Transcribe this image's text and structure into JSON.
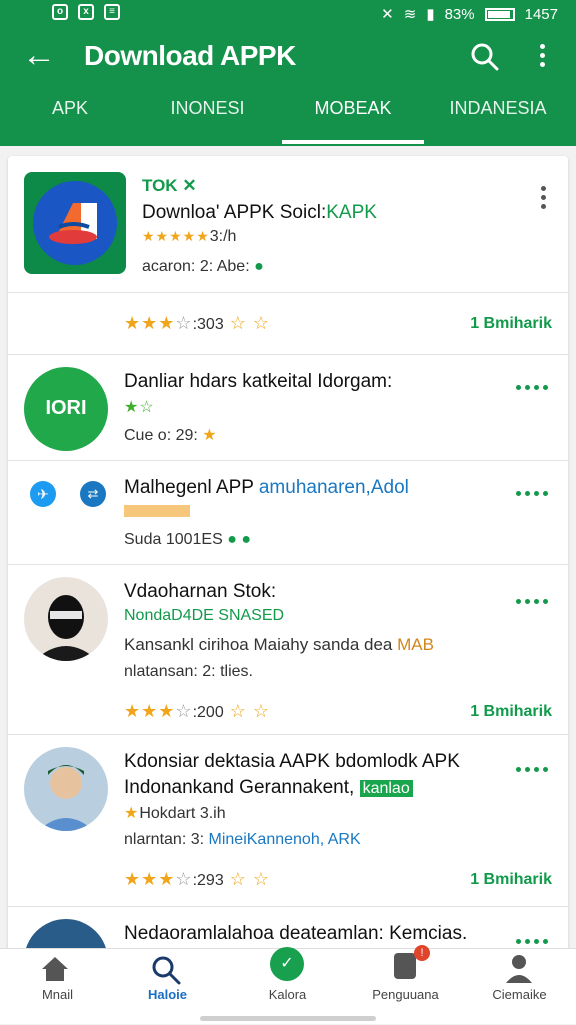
{
  "status": {
    "battery": "83%",
    "time": "1457"
  },
  "appbar": {
    "title": "Download APPK"
  },
  "tabs": [
    {
      "label": "APK"
    },
    {
      "label": "INONESI"
    },
    {
      "label": "MOBEAK"
    },
    {
      "label": "INDANESIA"
    }
  ],
  "featured": {
    "badge": "TOK",
    "name": "Downloa' APPK Soicl:",
    "name_accent": "KAPK",
    "rating_text": "3:/h",
    "meta": "acaron: 2: Abe:",
    "footer_rating": "303",
    "downloads": "1 Bmiharik"
  },
  "items": [
    {
      "title": "Danliar hdars katkeital Idorgam:",
      "logo_text": "IORI",
      "sub": "Cue o: 29: ",
      "rating": "",
      "downloads": ""
    },
    {
      "title": "Malhegenl APP",
      "title_accent": "amuhanaren,Adol",
      "sub": "Suda 1001ES",
      "rating": "",
      "downloads": ""
    },
    {
      "title": "Vdaoharnan Stok:",
      "subtitle": "NondaD4DE SNASED",
      "desc": "Kansankl cirihoa Maiahy sanda dea",
      "desc_accent": "MAB",
      "meta": "nlatansan: 2: tlies.",
      "rating": "200",
      "downloads": "1 Bmiharik"
    },
    {
      "title": "Kdonsiar dektasia AAPK bdomlodk APK",
      "subtitle": "Indonankand Gerannakent,",
      "subtitle_badge": "kanlao",
      "stars_text": "Hokdart 3.ih",
      "meta": "nlarntan: 3:",
      "meta_accent": "MineiKannenoh, ARK",
      "rating": "293",
      "downloads": "1 Bmiharik"
    },
    {
      "title": "Nedaoramlalahoa deateamlan: Kemcias."
    }
  ],
  "nav": [
    {
      "label": "Mnail"
    },
    {
      "label": "Haloie"
    },
    {
      "label": "Kalora"
    },
    {
      "label": "Penguuana"
    },
    {
      "label": "Ciemaike"
    }
  ]
}
